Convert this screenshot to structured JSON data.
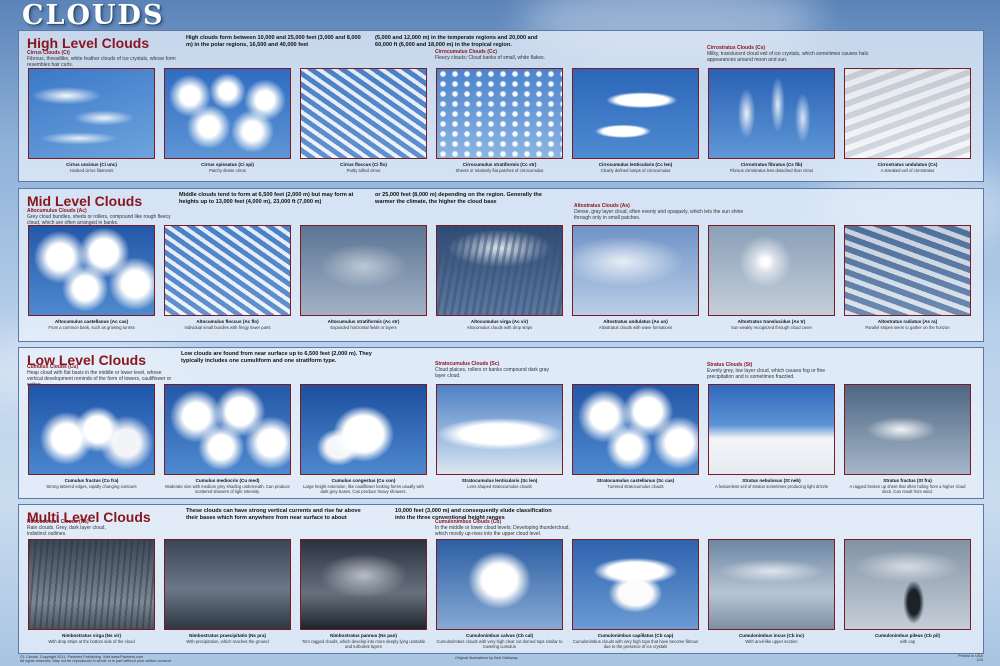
{
  "title": "CLOUDS",
  "sections": [
    {
      "name": "High Level Clouds",
      "desc1": "High clouds form between 10,000 and 25,000 feet (3,000 and 8,000 m) in the polar regions, 16,500 and 40,000 feet",
      "desc2": "(5,000 and 12,000 m) in the temperate regions and 20,000 and 60,000 ft (6,000 and 18,000 m) in the tropical region.",
      "labels": [
        {
          "cap": "Cirrus Clouds (Ci)",
          "desc": "Fibrous, threadlike, white feather clouds of ice crystals, whose form resembles hair curls."
        },
        {
          "cap": "Cirrocumulus Clouds (Cc)",
          "desc": "Fleecy clouds; Cloud banks of small, white flakes."
        },
        {
          "cap": "Cirrostratus Clouds (Cs)",
          "desc": "Milky, translucent cloud veil of ice crystals, which sometimes causes halo appearances around moon and sun."
        }
      ],
      "photos": [
        {
          "name": "Cirrus uncinus (Ci unc)",
          "desc": "Hooked cirrus filaments",
          "tex": "t-wisps"
        },
        {
          "name": "Cirrus spissatus (Ci spi)",
          "desc": "Patchy dense cirrus",
          "tex": "t-puffs"
        },
        {
          "name": "Cirrus floccus (Ci flo)",
          "desc": "Partly tufted cirrus",
          "tex": "t-streaks"
        },
        {
          "name": "Cirrocumulus stratiformis (Cc str)",
          "desc": "Sheets or relatively flat patches of cirrocumulus",
          "tex": "t-cells"
        },
        {
          "name": "Cirrocumulus lenticularis (Cc len)",
          "desc": "Clearly defined lumps of cirrocumulus",
          "tex": "t-lens"
        },
        {
          "name": "Cirrostratus fibratus (Cs fib)",
          "desc": "Fibrous cirrostratus less detached than cirrus",
          "tex": "t-fibrous"
        },
        {
          "name": "Cirrostratus undulatus (Cs)",
          "desc": "A streaked veil of cirrostratus",
          "tex": "t-haze"
        }
      ]
    },
    {
      "name": "Mid Level Clouds",
      "desc1": "Middle clouds tend to form at 6,500 feet (2,000 m) but may form at heights up to 13,000 feet (4,000 m), 23,000 ft (7,000 m)",
      "desc2": "or 25,000 feet (8,000 m) depending on the region. Generally the warmer the climate, the higher the cloud base",
      "labels": [
        {
          "cap": "Altocumulus Clouds (Ac)",
          "desc": "Grey cloud bundles, sheds or rollers, compound like rough fleecy cloud, which are often arranged in banks."
        },
        {
          "cap": "Altostratus Clouds (As)",
          "desc": "Dense, gray layer cloud, often evenly and opaquely, which lets the sun shine through only in small patches."
        }
      ],
      "photos": [
        {
          "name": "Altocumulus castellanus (Ac cas)",
          "desc": "From a common bank, such as growing turrets",
          "tex": "t-big-puffs"
        },
        {
          "name": "Altocumulus floccus (Ac flo)",
          "desc": "Individual small bundles with fringy lower parts",
          "tex": "t-streaks"
        },
        {
          "name": "Altocumulus stratiformis (Ac str)",
          "desc": "Expanded horizontal fields or layers",
          "tex": "t-grey-sky"
        },
        {
          "name": "Altocumulus virga (Ac vir)",
          "desc": "Altocumulus clouds with drop strips",
          "tex": "t-virga"
        },
        {
          "name": "Altostratus undulatus (As un)",
          "desc": "Altostratus clouds with wave formations",
          "tex": "t-sheet"
        },
        {
          "name": "Altostratus translucidus (As tr)",
          "desc": "Sun weakly recognized through cloud cover",
          "tex": "t-sun-veil"
        },
        {
          "name": "Altostratus radiatus (As ra)",
          "desc": "Parallel stripes seem to gather on the horizon",
          "tex": "t-rays"
        }
      ]
    },
    {
      "name": "Low Level Clouds",
      "desc1": "Low clouds are found from near surface up to 6,500 feet (2,000 m). They typically includes one cumuliform and one stratiform type.",
      "desc2": "",
      "labels": [
        {
          "cap": "Cumulus Clouds (Cu)",
          "desc": "Heap cloud with flat basis in the middle or lower level, whose vertical development reminds of the form of towers, cauliflower or cotton."
        },
        {
          "cap": "Stratocumulus Clouds (Sc)",
          "desc": "Cloud plaices, rollers or banks compound dark gray layer cloud."
        },
        {
          "cap": "Stratus Clouds (St)",
          "desc": "Evenly grey, low layer cloud, which causes fog or fine precipitation and is sometimes frazzled."
        }
      ],
      "photos": [
        {
          "name": "Cumulus fractus (Cu fra)",
          "desc": "Strong tattered edges, rapidly changing contours",
          "tex": "t-cumulus"
        },
        {
          "name": "Cumulus mediocris (Cu med)",
          "desc": "Moderate size with medium grey shading underneath. Can produce scattered showers of light intensity.",
          "tex": "t-big-puffs"
        },
        {
          "name": "Cumulus congestus (Cu con)",
          "desc": "Large height extension, like cauliflower looking forms usually with dark grey bases. Can produce heavy showers.",
          "tex": "t-tower"
        },
        {
          "name": "Stratocumulus lenticularis (Sc len)",
          "desc": "Lens shaped stratocumulus clouds",
          "tex": "t-strato"
        },
        {
          "name": "Stratocumulus castellanus (Sc cas)",
          "desc": "Turreted stratocumulus clouds",
          "tex": "t-big-puffs"
        },
        {
          "name": "Stratus nebulosus (St neb)",
          "desc": "A featureless veil of stratus sometimes producing light drizzle",
          "tex": "t-flat-white"
        },
        {
          "name": "Stratus fractus (St fra)",
          "desc": "A ragged broken up sheet that often hiding from a higher cloud deck. Can result from wind.",
          "tex": "t-fractus"
        }
      ]
    },
    {
      "name": "Multi Level Clouds",
      "desc1": "These clouds can have strong vertical currents and rise far above their bases which form anywhere from near surface to about",
      "desc2": "10,000 feet (3,000 m) and consequently elude classification into the three conventional height ranges",
      "labels": [
        {
          "cap": "Nimbostratus Clouds (Ns)",
          "desc": "Rain clouds. Grey, dark layer cloud, indistinct outlines."
        },
        {
          "cap": "Cumulonimbus Clouds (Cb)",
          "desc": "In the middle or lower cloud levels; Developing thundercloud, which mostly up-rises into the upper cloud level."
        }
      ],
      "photos": [
        {
          "name": "Nimbostratus virga (Ns vir)",
          "desc": "With drop strips at the bottom side of the cloud",
          "tex": "t-rain"
        },
        {
          "name": "Nimbostratus praecipitatio (Ns pra)",
          "desc": "With precipitation, which reaches the ground",
          "tex": "t-dark"
        },
        {
          "name": "Nimbostratus pannus (Ns pan)",
          "desc": "Torn ragged clouds, which develop into more deeply lying unstable and turbulent layers",
          "tex": "t-storm"
        },
        {
          "name": "Cumulonimbus calvus (Cb cal)",
          "desc": "Cumulonimbus clouds with very high clear cut domed tops similar to towering cumulus",
          "tex": "t-cb-tower"
        },
        {
          "name": "Cumulonimbus capillatus (Cb cap)",
          "desc": "Cumulonimbus clouds with very high tops that have become fibrous due to the presence of ice crystals",
          "tex": "t-anvil"
        },
        {
          "name": "Cumulonimbus incus (Cb inc)",
          "desc": "With anvil-like upper section",
          "tex": "t-incus"
        },
        {
          "name": "Cumulonimbus pileus (Cb pil)",
          "desc": "with cap",
          "tex": "t-pileus"
        }
      ]
    }
  ],
  "footer": {
    "left": "©1 Clouds. Copyright 2011. Palmiers Publishing. Visit www.Palmiers.com",
    "left2": "All rights reserved. May not be reproduced in whole or in part without prior written consent.",
    "center": "Original illustrations by Bob Galloway",
    "right": "Printed in USA",
    "right2": "103"
  }
}
